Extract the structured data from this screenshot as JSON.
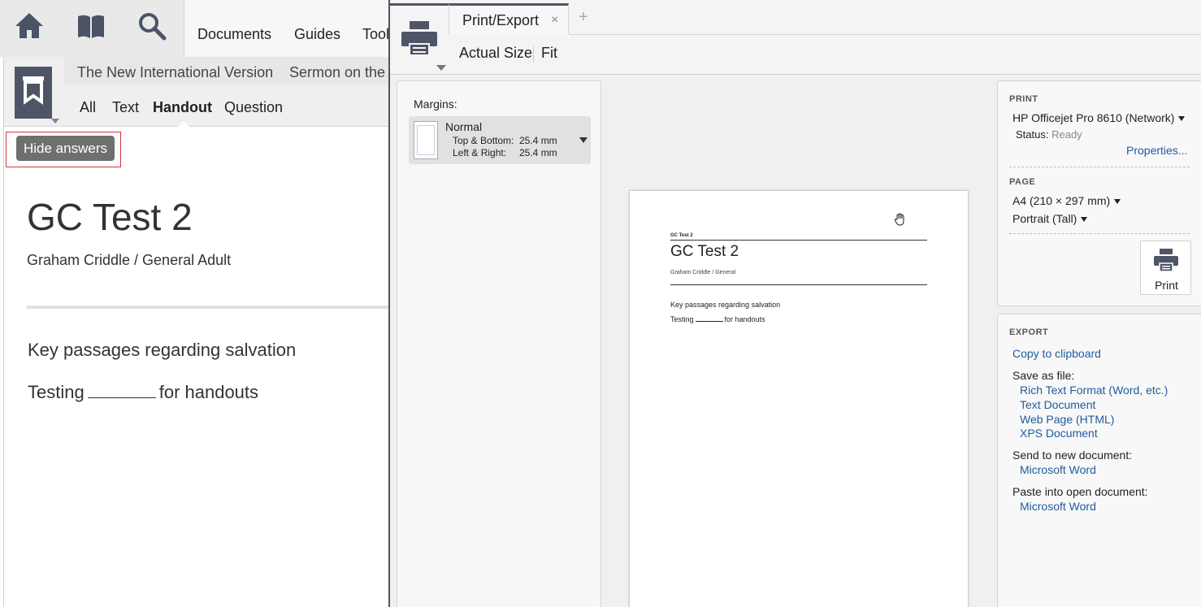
{
  "app": {
    "nav": [
      "Documents",
      "Guides",
      "Tools"
    ],
    "doc_tabs": [
      "The New International Version",
      "Sermon on the Mount"
    ],
    "sub_tabs": [
      "All",
      "Text",
      "Handout",
      "Question"
    ],
    "hide_answers": "Hide answers"
  },
  "document": {
    "title": "GC Test 2",
    "author": "Graham Criddle / General Adult",
    "line1": "Key passages regarding salvation",
    "line2_before": "Testing",
    "line2_after": "for handouts"
  },
  "print_export": {
    "tab_label": "Print/Export",
    "tab_close": "×",
    "tab_add": "+",
    "actual_size": "Actual Size",
    "fit": "Fit",
    "margins": {
      "label": "Margins:",
      "name": "Normal",
      "top_bottom_label": "Top & Bottom:",
      "top_bottom_value": "25.4 mm",
      "left_right_label": "Left & Right:",
      "left_right_value": "25.4 mm"
    },
    "preview": {
      "small_title": "GC Test 2",
      "title": "GC Test 2",
      "author": "Graham Criddle / General",
      "line1": "Key passages regarding salvation",
      "line2_before": "Testing",
      "line2_after": "for handouts"
    },
    "print": {
      "heading": "PRINT",
      "printer": "HP Officejet Pro 8610 (Network)",
      "status_label": "Status:",
      "status_value": "Ready",
      "properties": "Properties...",
      "page_heading": "PAGE",
      "paper": "A4 (210 × 297 mm)",
      "orientation": "Portrait (Tall)",
      "print_button": "Print"
    },
    "export": {
      "heading": "EXPORT",
      "copy": "Copy to clipboard",
      "save_as_label": "Save as file:",
      "save_options": [
        "Rich Text Format (Word, etc.)",
        "Text Document",
        "Web Page (HTML)",
        "XPS Document"
      ],
      "send_label": "Send to new document:",
      "send_option": "Microsoft Word",
      "paste_label": "Paste into open document:",
      "paste_option": "Microsoft Word"
    }
  },
  "colors": {
    "accent": "#4d5566",
    "link": "#1f5b9e",
    "highlight_box": "#d9343f"
  }
}
